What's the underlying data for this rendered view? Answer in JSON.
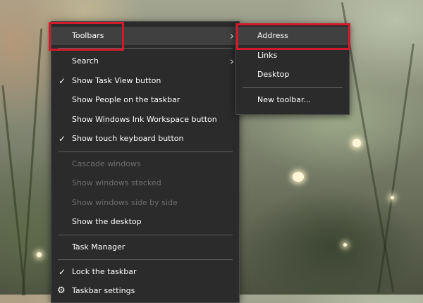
{
  "main_menu": {
    "items": [
      {
        "label": "Toolbars",
        "submenu_arrow": "›"
      },
      {
        "label": "Search",
        "submenu_arrow": "›"
      },
      {
        "label": "Show Task View button",
        "check": "✓"
      },
      {
        "label": "Show People on the taskbar"
      },
      {
        "label": "Show Windows Ink Workspace button"
      },
      {
        "label": "Show touch keyboard button",
        "check": "✓"
      },
      {
        "label": "Cascade windows",
        "disabled": true
      },
      {
        "label": "Show windows stacked",
        "disabled": true
      },
      {
        "label": "Show windows side by side",
        "disabled": true
      },
      {
        "label": "Show the desktop"
      },
      {
        "label": "Task Manager"
      },
      {
        "label": "Lock the taskbar",
        "check": "✓"
      },
      {
        "label": "Taskbar settings",
        "icon": "gear-icon",
        "glyph": "⚙"
      }
    ]
  },
  "sub_menu": {
    "items": [
      {
        "label": "Address"
      },
      {
        "label": "Links"
      },
      {
        "label": "Desktop"
      },
      {
        "label": "New toolbar..."
      }
    ]
  },
  "colors": {
    "menu_bg": "#2b2b2b",
    "highlight": "#d11a2a",
    "text": "#ffffff",
    "disabled_text": "#6e6e6e"
  }
}
